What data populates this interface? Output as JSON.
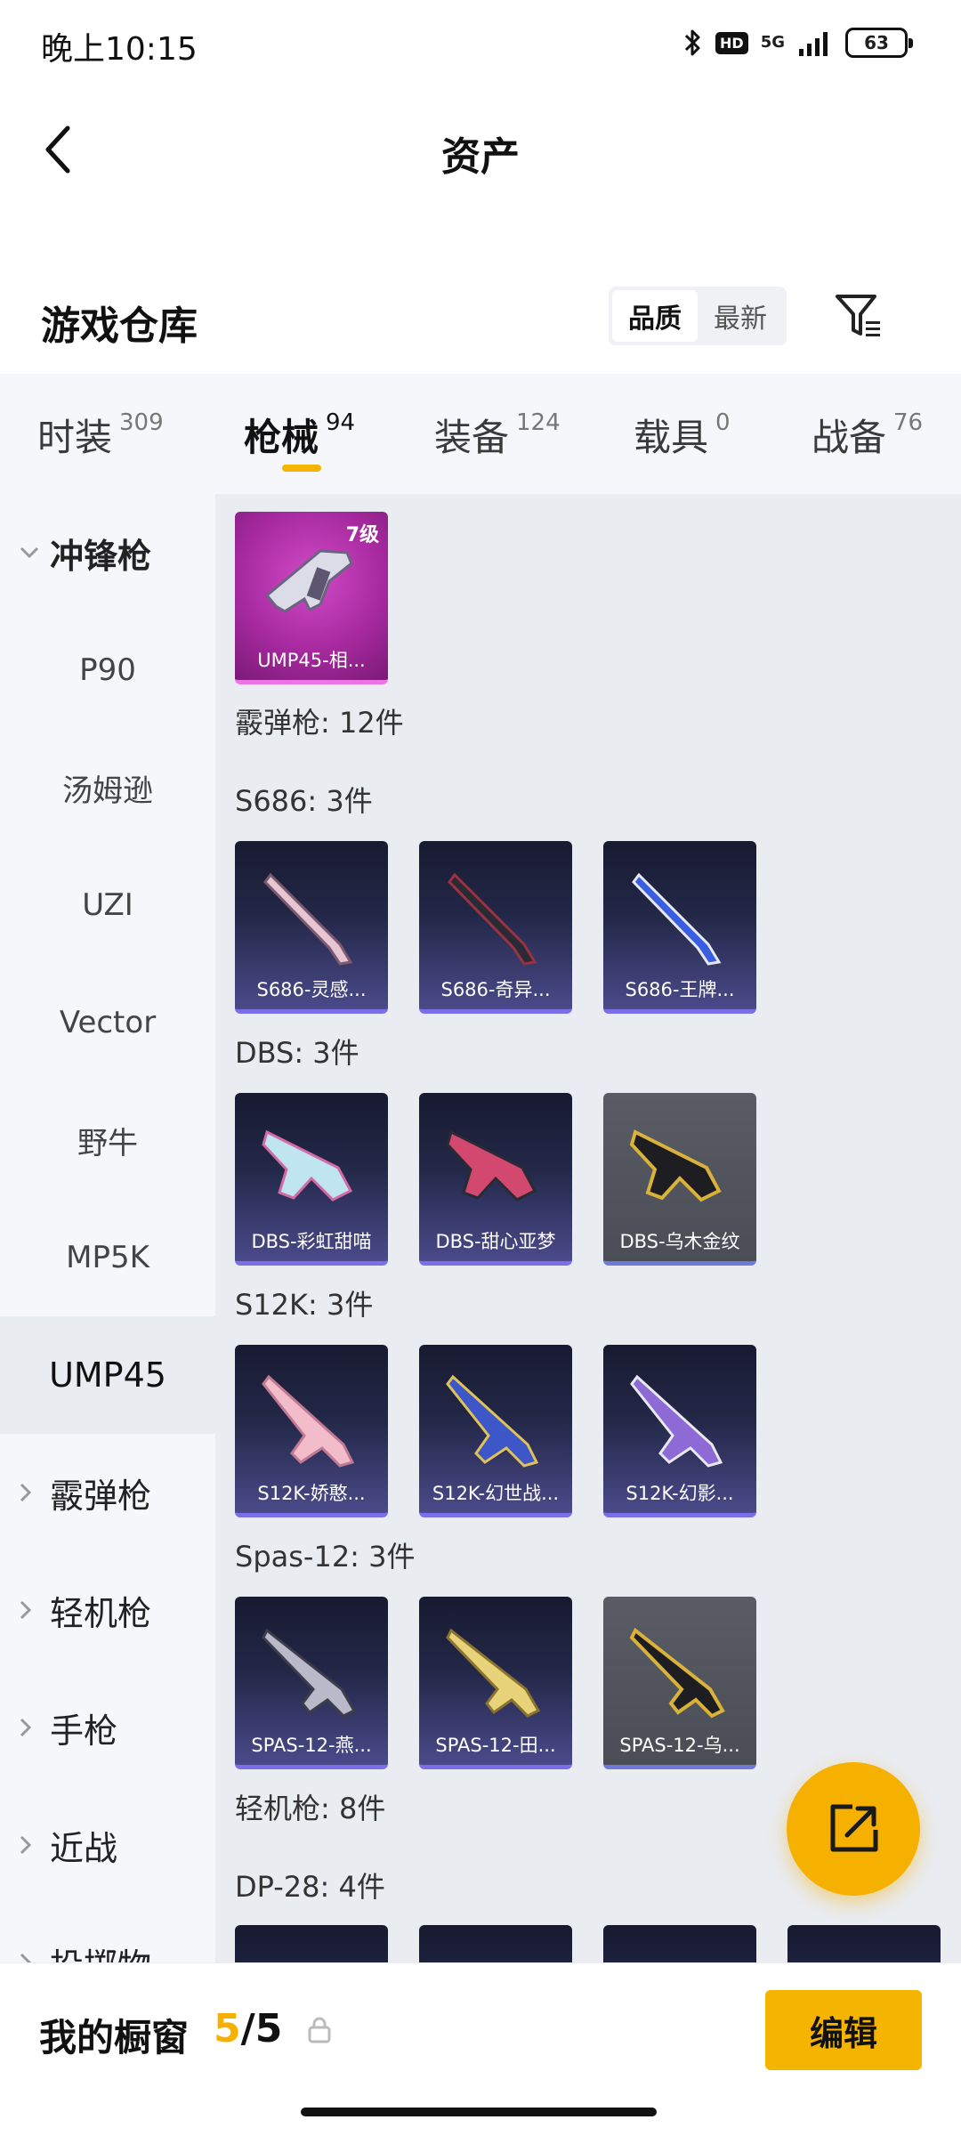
{
  "status_bar": {
    "time": "晚上10:15",
    "hd": "HD",
    "network": "5G",
    "battery": "63"
  },
  "header": {
    "title": "资产"
  },
  "section": {
    "title": "游戏仓库",
    "sort_options": [
      "品质",
      "最新"
    ],
    "sort_selected": "品质"
  },
  "tabs": [
    {
      "label": "时装",
      "count": "309"
    },
    {
      "label": "枪械",
      "count": "94"
    },
    {
      "label": "装备",
      "count": "124"
    },
    {
      "label": "载具",
      "count": "0"
    },
    {
      "label": "战备",
      "count": "76"
    }
  ],
  "active_tab": "枪械",
  "sidebar": {
    "items": [
      {
        "label": "冲锋枪"
      },
      {
        "label": "P90"
      },
      {
        "label": "汤姆逊"
      },
      {
        "label": "UZI"
      },
      {
        "label": "Vector"
      },
      {
        "label": "野牛"
      },
      {
        "label": "MP5K"
      },
      {
        "label": "UMP45"
      },
      {
        "label": "霰弹枪"
      },
      {
        "label": "轻机枪"
      },
      {
        "label": "手枪"
      },
      {
        "label": "近战"
      },
      {
        "label": "投掷物"
      }
    ],
    "selected": "UMP45"
  },
  "content": {
    "ump_card": {
      "name": "UMP45-相...",
      "level": "7级"
    },
    "shotgun_header": "霰弹枪: 12件",
    "groups": [
      {
        "title": "S686: 3件",
        "items": [
          "S686-灵感...",
          "S686-奇异...",
          "S686-王牌..."
        ]
      },
      {
        "title": "DBS: 3件",
        "items": [
          "DBS-彩虹甜喵",
          "DBS-甜心亚梦",
          "DBS-乌木金纹"
        ]
      },
      {
        "title": "S12K: 3件",
        "items": [
          "S12K-娇憨...",
          "S12K-幻世战...",
          "S12K-幻影..."
        ]
      },
      {
        "title": "Spas-12: 3件",
        "items": [
          "SPAS-12-燕...",
          "SPAS-12-田...",
          "SPAS-12-乌..."
        ]
      }
    ],
    "lmg_header": "轻机枪: 8件",
    "dp28_header": "DP-28: 4件"
  },
  "bottom": {
    "showcase_label": "我的橱窗",
    "count_current": "5",
    "count_sep": "/",
    "count_max": "5",
    "edit_label": "编辑"
  },
  "colors": {
    "accent": "#f5b400",
    "content_bg": "#e9ecf1",
    "sidebar_bg": "#f5f7fa"
  }
}
